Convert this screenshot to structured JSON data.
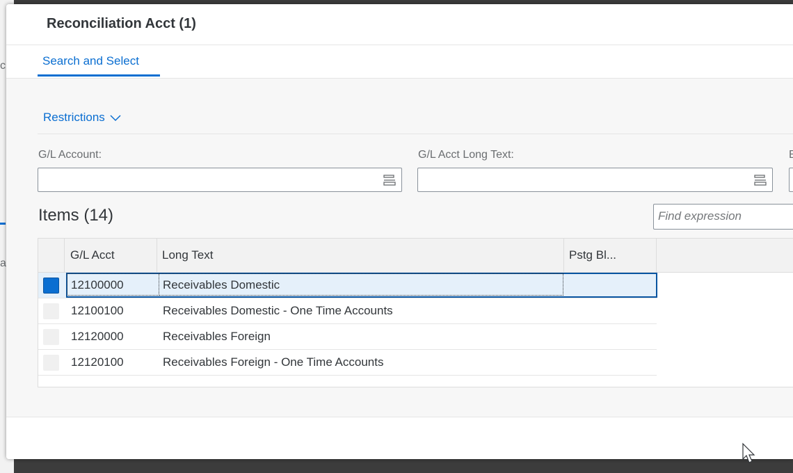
{
  "background": {
    "left_chars": [
      "c",
      "a"
    ]
  },
  "dialog": {
    "title": "Reconciliation Acct (1)",
    "tabs": [
      {
        "label": "Search and Select",
        "active": true
      }
    ],
    "restrictions_label": "Restrictions",
    "filters": [
      {
        "label": "G/L Account:",
        "value": ""
      },
      {
        "label": "G/L Acct Long Text:",
        "value": ""
      },
      {
        "label": "B",
        "value": ""
      }
    ],
    "items_title": "Items (14)",
    "search": {
      "placeholder": "Find expression"
    },
    "table": {
      "columns": [
        "G/L Acct",
        "Long Text",
        "Pstg Bl..."
      ],
      "rows": [
        {
          "gl_acct": "12100000",
          "long_text": "Receivables Domestic",
          "pstg_bl": "",
          "selected": true
        },
        {
          "gl_acct": "12100100",
          "long_text": "Receivables Domestic - One Time Accounts",
          "pstg_bl": "",
          "selected": false
        },
        {
          "gl_acct": "12120000",
          "long_text": "Receivables Foreign",
          "pstg_bl": "",
          "selected": false
        },
        {
          "gl_acct": "12120100",
          "long_text": "Receivables Foreign - One Time Accounts",
          "pstg_bl": "",
          "selected": false
        }
      ]
    }
  },
  "colors": {
    "accent": "#0a6ed1",
    "selected_row": "#e5f0fa",
    "header_bg": "#f2f2f2"
  }
}
